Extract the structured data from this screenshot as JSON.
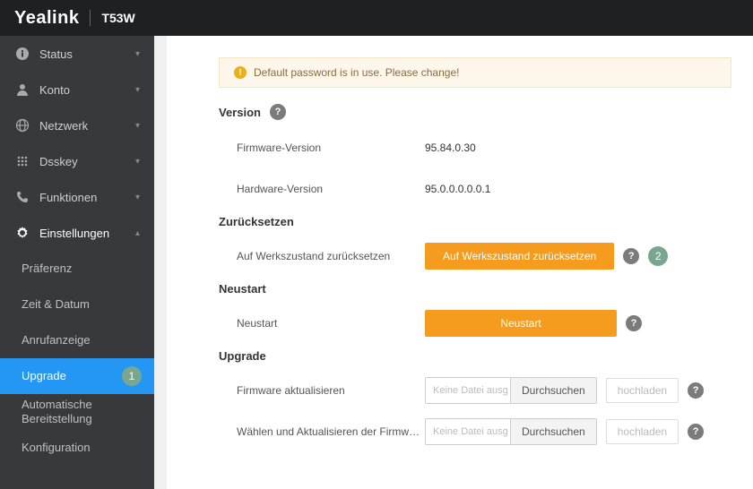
{
  "header": {
    "brand": "Yealink",
    "model": "T53W"
  },
  "sidebar": {
    "items": [
      {
        "label": "Status"
      },
      {
        "label": "Konto"
      },
      {
        "label": "Netzwerk"
      },
      {
        "label": "Dsskey"
      },
      {
        "label": "Funktionen"
      },
      {
        "label": "Einstellungen"
      }
    ],
    "sub": [
      {
        "label": "Präferenz"
      },
      {
        "label": "Zeit & Datum"
      },
      {
        "label": "Anrufanzeige"
      },
      {
        "label": "Upgrade",
        "badge": "1"
      },
      {
        "label": "Automatische Bereitstellung"
      },
      {
        "label": "Konfiguration"
      }
    ]
  },
  "notice": "Default password is in use. Please change!",
  "version": {
    "title": "Version",
    "firmware_label": "Firmware-Version",
    "firmware_value": "95.84.0.30",
    "hardware_label": "Hardware-Version",
    "hardware_value": "95.0.0.0.0.0.1"
  },
  "reset": {
    "title": "Zurücksetzen",
    "label": "Auf Werkszustand zurücksetzen",
    "button": "Auf Werkszustand zurücksetzen",
    "badge": "2"
  },
  "restart": {
    "title": "Neustart",
    "label": "Neustart",
    "button": "Neustart"
  },
  "upgrade": {
    "title": "Upgrade",
    "firmware_label": "Firmware aktualisieren",
    "file_placeholder": "Keine Datei ausg",
    "browse": "Durchsuchen",
    "upload": "hochladen",
    "select_label": "Wählen und Aktualisieren der Firmware de…"
  },
  "help": "?"
}
